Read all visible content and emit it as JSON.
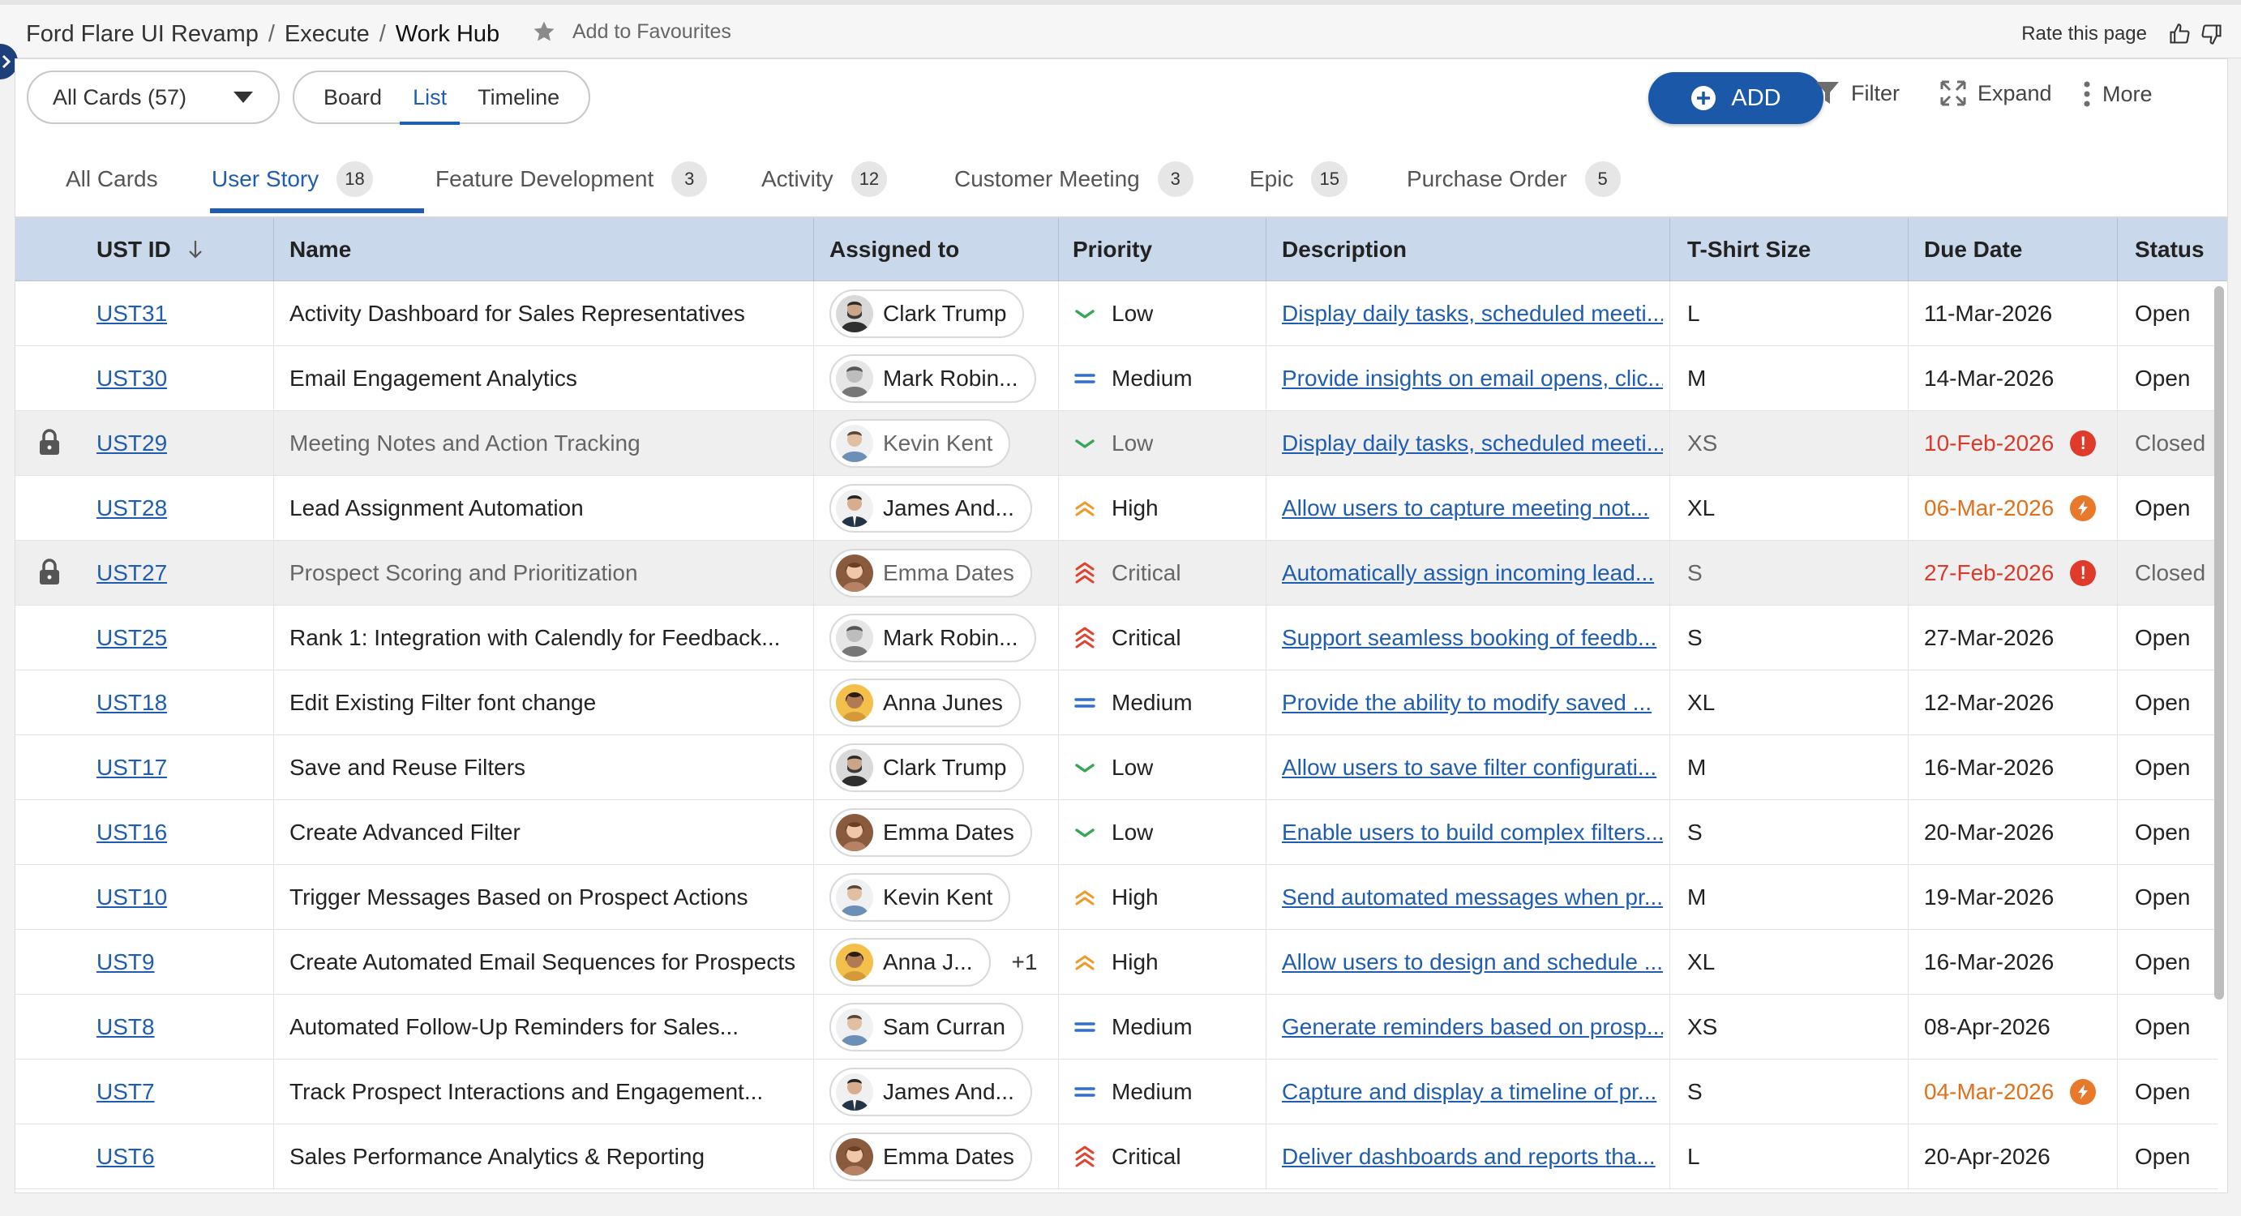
{
  "breadcrumb": {
    "items": [
      "Ford Flare UI Revamp",
      "Execute",
      "Work Hub"
    ],
    "favourite_label": "Add to Favourites",
    "rate_label": "Rate this page"
  },
  "toolbar": {
    "filter_select": "All Cards (57)",
    "views": [
      "Board",
      "List",
      "Timeline"
    ],
    "active_view": "List",
    "add_label": "ADD",
    "filter_label": "Filter",
    "expand_label": "Expand",
    "more_label": "More"
  },
  "tabs": [
    {
      "label": "All Cards",
      "count": ""
    },
    {
      "label": "User Story",
      "count": "18"
    },
    {
      "label": "Feature Development",
      "count": "3"
    },
    {
      "label": "Activity",
      "count": "12"
    },
    {
      "label": "Customer Meeting",
      "count": "3"
    },
    {
      "label": "Epic",
      "count": "15"
    },
    {
      "label": "Purchase Order",
      "count": "5"
    }
  ],
  "active_tab": "User Story",
  "columns": {
    "id": "UST ID",
    "name": "Name",
    "assigned": "Assigned to",
    "priority": "Priority",
    "description": "Description",
    "size": "T-Shirt Size",
    "due": "Due Date",
    "status": "Status"
  },
  "colors": {
    "accent": "#1f5db2",
    "header_bg": "#c9d8ea",
    "overdue": "#d93a2b",
    "due_soon": "#e0701a",
    "priority_low": "#3aa655",
    "priority_medium": "#2f6fd1",
    "priority_high": "#f09a2c",
    "priority_critical": "#e0442f"
  },
  "rows": [
    {
      "id": "UST31",
      "name": "Activity Dashboard for Sales Representatives",
      "assignee": "Clark Trump",
      "avatar": "man-beard",
      "extra": "",
      "priority": "Low",
      "description": "Display daily tasks, scheduled meeti...",
      "size": "L",
      "due": "11-Mar-2026",
      "due_flag": "",
      "status": "Open",
      "locked": false
    },
    {
      "id": "UST30",
      "name": "Email Engagement Analytics",
      "assignee": "Mark Robin...",
      "avatar": "man-grey",
      "extra": "",
      "priority": "Medium",
      "description": "Provide insights on email opens, clic...",
      "size": "M",
      "due": "14-Mar-2026",
      "due_flag": "",
      "status": "Open",
      "locked": false
    },
    {
      "id": "UST29",
      "name": "Meeting Notes and Action Tracking",
      "assignee": "Kevin Kent",
      "avatar": "man-light",
      "extra": "",
      "priority": "Low",
      "description": "Display daily tasks, scheduled meeti...",
      "size": "XS",
      "due": "10-Feb-2026",
      "due_flag": "overdue",
      "status": "Closed",
      "locked": true
    },
    {
      "id": "UST28",
      "name": "Lead Assignment Automation",
      "assignee": "James And...",
      "avatar": "man-suit",
      "extra": "",
      "priority": "High",
      "description": "Allow users to capture meeting not...",
      "size": "XL",
      "due": "06-Mar-2026",
      "due_flag": "soon",
      "status": "Open",
      "locked": false
    },
    {
      "id": "UST27",
      "name": "Prospect Scoring and Prioritization",
      "assignee": "Emma Dates",
      "avatar": "woman-brown",
      "extra": "",
      "priority": "Critical",
      "description": "Automatically assign incoming lead...",
      "size": "S",
      "due": "27-Feb-2026",
      "due_flag": "overdue",
      "status": "Closed",
      "locked": true
    },
    {
      "id": "UST25",
      "name": "Rank 1: Integration with Calendly for Feedback...",
      "assignee": "Mark Robin...",
      "avatar": "man-grey",
      "extra": "",
      "priority": "Critical",
      "description": "Support seamless booking of feedb...",
      "size": "S",
      "due": "27-Mar-2026",
      "due_flag": "",
      "status": "Open",
      "locked": false
    },
    {
      "id": "UST18",
      "name": "Edit Existing Filter font change",
      "assignee": "Anna Junes",
      "avatar": "woman-yellow",
      "extra": "",
      "priority": "Medium",
      "description": "Provide the ability to modify saved ...",
      "size": "XL",
      "due": "12-Mar-2026",
      "due_flag": "",
      "status": "Open",
      "locked": false
    },
    {
      "id": "UST17",
      "name": "Save and Reuse Filters",
      "assignee": "Clark Trump",
      "avatar": "man-beard",
      "extra": "",
      "priority": "Low",
      "description": "Allow users to save filter configurati...",
      "size": "M",
      "due": "16-Mar-2026",
      "due_flag": "",
      "status": "Open",
      "locked": false
    },
    {
      "id": "UST16",
      "name": "Create Advanced Filter",
      "assignee": "Emma Dates",
      "avatar": "woman-brown",
      "extra": "",
      "priority": "Low",
      "description": "Enable users to build complex filters...",
      "size": "S",
      "due": "20-Mar-2026",
      "due_flag": "",
      "status": "Open",
      "locked": false
    },
    {
      "id": "UST10",
      "name": "Trigger Messages Based on Prospect Actions",
      "assignee": "Kevin Kent",
      "avatar": "man-light",
      "extra": "",
      "priority": "High",
      "description": "Send automated messages when pr...",
      "size": "M",
      "due": "19-Mar-2026",
      "due_flag": "",
      "status": "Open",
      "locked": false
    },
    {
      "id": "UST9",
      "name": "Create Automated Email Sequences for Prospects",
      "assignee": "Anna J...",
      "avatar": "woman-yellow",
      "extra": "+1",
      "priority": "High",
      "description": "Allow users to design and schedule ...",
      "size": "XL",
      "due": "16-Mar-2026",
      "due_flag": "",
      "status": "Open",
      "locked": false
    },
    {
      "id": "UST8",
      "name": "Automated Follow-Up Reminders for Sales...",
      "assignee": "Sam Curran",
      "avatar": "man-light",
      "extra": "",
      "priority": "Medium",
      "description": "Generate reminders based on prosp...",
      "size": "XS",
      "due": "08-Apr-2026",
      "due_flag": "",
      "status": "Open",
      "locked": false
    },
    {
      "id": "UST7",
      "name": "Track Prospect Interactions and Engagement...",
      "assignee": "James And...",
      "avatar": "man-suit",
      "extra": "",
      "priority": "Medium",
      "description": "Capture and display a timeline of pr...",
      "size": "S",
      "due": "04-Mar-2026",
      "due_flag": "soon",
      "status": "Open",
      "locked": false
    },
    {
      "id": "UST6",
      "name": "Sales Performance Analytics & Reporting",
      "assignee": "Emma Dates",
      "avatar": "woman-brown",
      "extra": "",
      "priority": "Critical",
      "description": "Deliver dashboards and reports tha...",
      "size": "L",
      "due": "20-Apr-2026",
      "due_flag": "",
      "status": "Open",
      "locked": false
    }
  ]
}
